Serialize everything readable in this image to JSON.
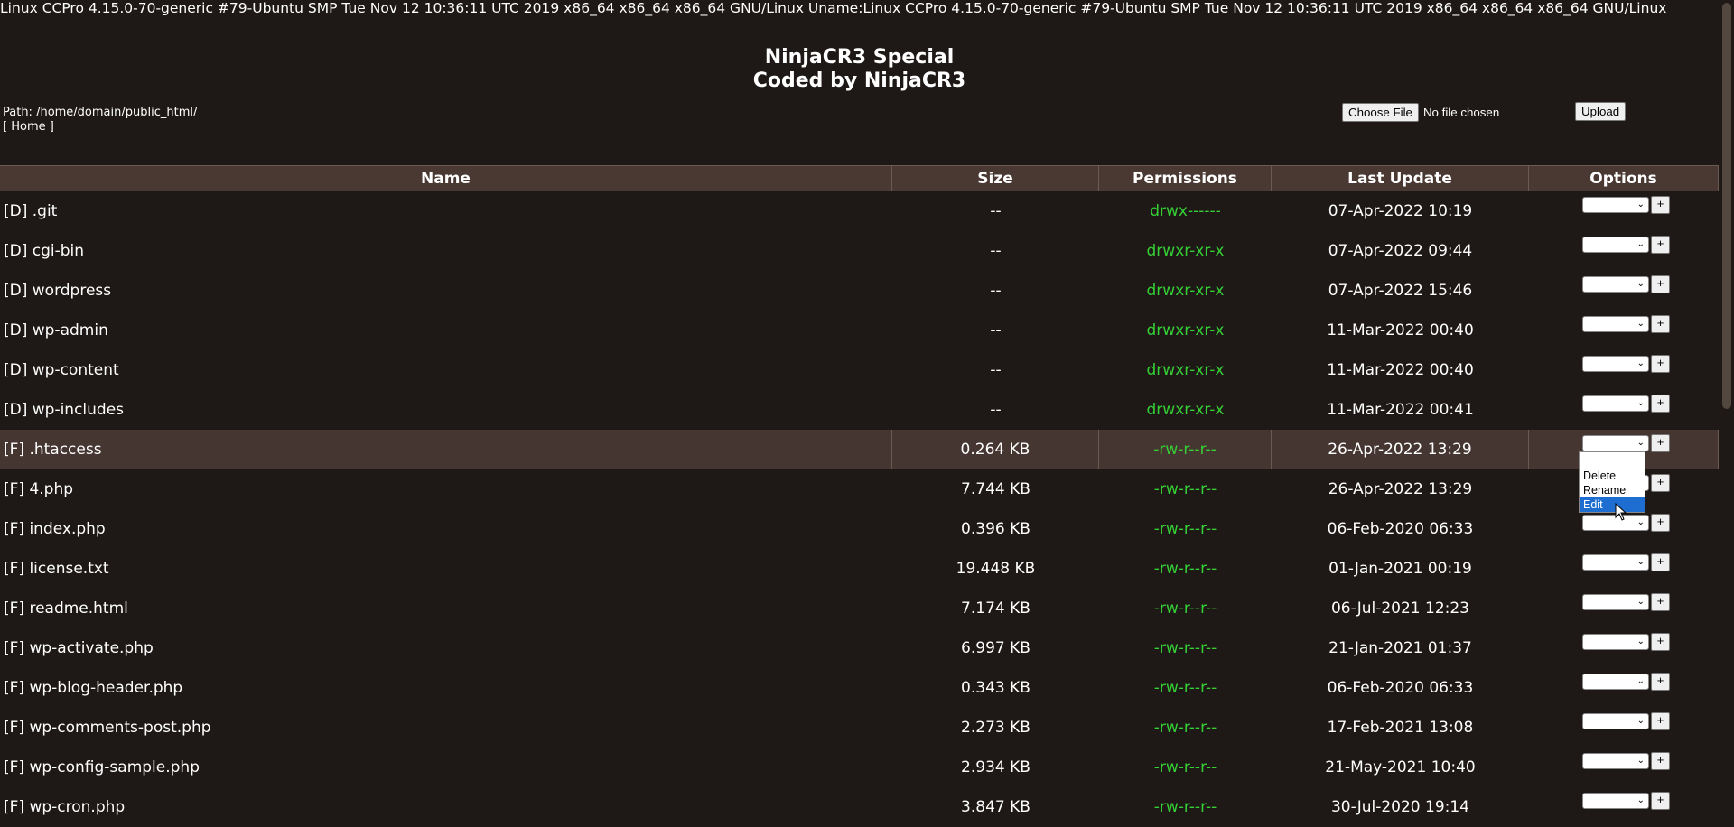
{
  "uname": "Linux CCPro 4.15.0-70-generic #79-Ubuntu SMP Tue Nov 12 10:36:11 UTC 2019 x86_64 x86_64 x86_64 GNU/Linux Uname:Linux CCPro 4.15.0-70-generic #79-Ubuntu SMP Tue Nov 12 10:36:11 UTC 2019 x86_64 x86_64 x86_64 GNU/Linux",
  "title_line1": "NinjaCR3 Special",
  "title_line2": "Coded by NinjaCR3",
  "path_label": "Path: /home/domain/public_html/",
  "home_prefix": "[",
  "home_link": "Home",
  "home_suffix": "]",
  "upload": {
    "choose_label": "Choose File",
    "no_file": "No file chosen",
    "upload_label": "Upload"
  },
  "headers": {
    "name": "Name",
    "size": "Size",
    "permissions": "Permissions",
    "last_update": "Last Update",
    "options": "Options"
  },
  "plus_label": "+",
  "dropdown": {
    "options": [
      "Delete",
      "Rename",
      "Edit"
    ],
    "active": "Edit"
  },
  "rows": [
    {
      "name": "[D] .git",
      "size": "--",
      "perm": "drwx------",
      "date": "07-Apr-2022 10:19"
    },
    {
      "name": "[D] cgi-bin",
      "size": "--",
      "perm": "drwxr-xr-x",
      "date": "07-Apr-2022 09:44"
    },
    {
      "name": "[D] wordpress",
      "size": "--",
      "perm": "drwxr-xr-x",
      "date": "07-Apr-2022 15:46"
    },
    {
      "name": "[D] wp-admin",
      "size": "--",
      "perm": "drwxr-xr-x",
      "date": "11-Mar-2022 00:40"
    },
    {
      "name": "[D] wp-content",
      "size": "--",
      "perm": "drwxr-xr-x",
      "date": "11-Mar-2022 00:40"
    },
    {
      "name": "[D] wp-includes",
      "size": "--",
      "perm": "drwxr-xr-x",
      "date": "11-Mar-2022 00:41"
    },
    {
      "name": "[F] .htaccess",
      "size": "0.264 KB",
      "perm": "-rw-r--r--",
      "date": "26-Apr-2022 13:29",
      "highlighted": true
    },
    {
      "name": "[F] 4.php",
      "size": "7.744 KB",
      "perm": "-rw-r--r--",
      "date": "26-Apr-2022 13:29"
    },
    {
      "name": "[F] index.php",
      "size": "0.396 KB",
      "perm": "-rw-r--r--",
      "date": "06-Feb-2020 06:33"
    },
    {
      "name": "[F] license.txt",
      "size": "19.448 KB",
      "perm": "-rw-r--r--",
      "date": "01-Jan-2021 00:19"
    },
    {
      "name": "[F] readme.html",
      "size": "7.174 KB",
      "perm": "-rw-r--r--",
      "date": "06-Jul-2021 12:23"
    },
    {
      "name": "[F] wp-activate.php",
      "size": "6.997 KB",
      "perm": "-rw-r--r--",
      "date": "21-Jan-2021 01:37"
    },
    {
      "name": "[F] wp-blog-header.php",
      "size": "0.343 KB",
      "perm": "-rw-r--r--",
      "date": "06-Feb-2020 06:33"
    },
    {
      "name": "[F] wp-comments-post.php",
      "size": "2.273 KB",
      "perm": "-rw-r--r--",
      "date": "17-Feb-2021 13:08"
    },
    {
      "name": "[F] wp-config-sample.php",
      "size": "2.934 KB",
      "perm": "-rw-r--r--",
      "date": "21-May-2021 10:40"
    },
    {
      "name": "[F] wp-cron.php",
      "size": "3.847 KB",
      "perm": "-rw-r--r--",
      "date": "30-Jul-2020 19:14"
    }
  ]
}
